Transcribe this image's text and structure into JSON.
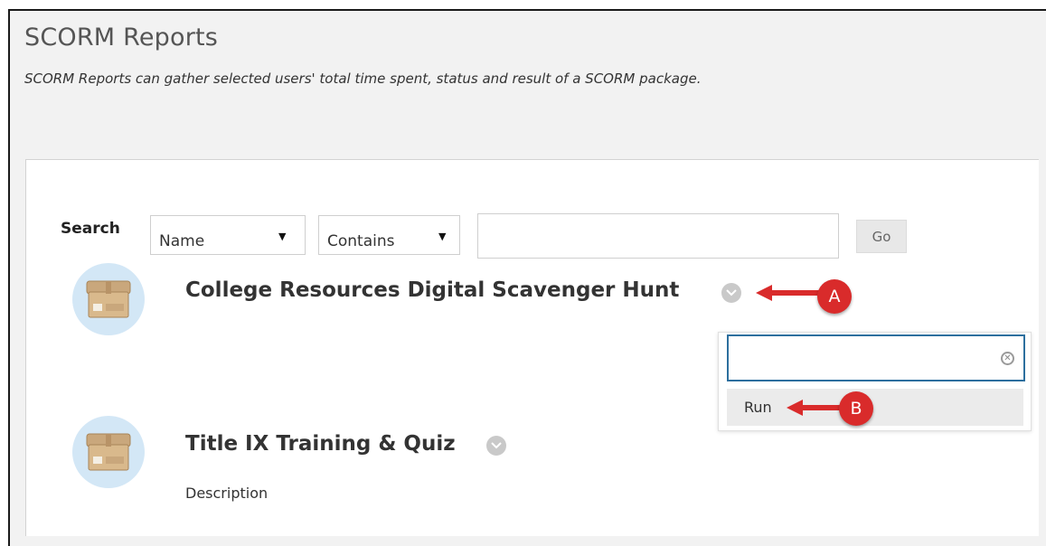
{
  "page": {
    "title": "SCORM Reports",
    "subtitle": "SCORM Reports can gather selected users' total time spent, status and result of a SCORM package."
  },
  "search": {
    "label": "Search",
    "field_select": "Name",
    "operator_select": "Contains",
    "input_value": "",
    "go_label": "Go"
  },
  "items": [
    {
      "title": "College Resources Digital Scavenger Hunt",
      "description": ""
    },
    {
      "title": "Title IX Training & Quiz",
      "description": "Description"
    }
  ],
  "menu": {
    "filter_value": "",
    "options": [
      "Run"
    ]
  },
  "annotations": {
    "a": "A",
    "b": "B",
    "color": "#d92b2b"
  },
  "icons": {
    "package": "package-box-icon",
    "chevron": "chevron-down-icon",
    "clear": "clear-icon",
    "caret": "caret-down-icon"
  }
}
